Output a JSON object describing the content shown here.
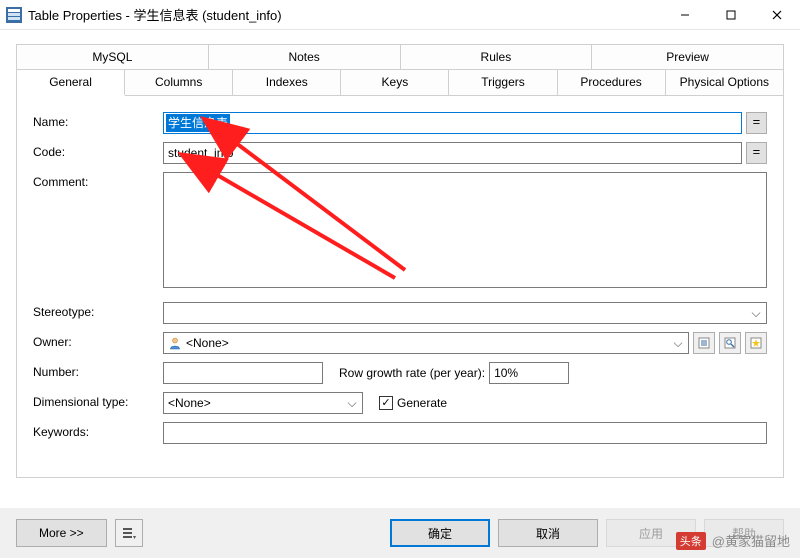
{
  "window": {
    "title": "Table Properties - 学生信息表 (student_info)"
  },
  "tabs_top": {
    "mysql": "MySQL",
    "notes": "Notes",
    "rules": "Rules",
    "preview": "Preview"
  },
  "tabs_bottom": {
    "general": "General",
    "columns": "Columns",
    "indexes": "Indexes",
    "keys": "Keys",
    "triggers": "Triggers",
    "procedures": "Procedures",
    "physical": "Physical Options"
  },
  "labels": {
    "name": "Name:",
    "code": "Code:",
    "comment": "Comment:",
    "stereotype": "Stereotype:",
    "owner": "Owner:",
    "number": "Number:",
    "row_growth": "Row growth rate (per year):",
    "dimensional": "Dimensional type:",
    "generate": "Generate",
    "keywords": "Keywords:"
  },
  "fields": {
    "name": "学生信息表",
    "code": "student_info",
    "comment": "",
    "stereotype": "",
    "owner": "<None>",
    "number": "",
    "row_growth": "10%",
    "dimensional": "<None>",
    "generate_checked": "✓",
    "keywords": ""
  },
  "buttons": {
    "more": "More >>",
    "ok": "确定",
    "cancel": "取消",
    "apply": "应用",
    "help": "帮助",
    "eq": "="
  },
  "watermark": {
    "badge": "头条",
    "text": "@黄家猫留地"
  }
}
